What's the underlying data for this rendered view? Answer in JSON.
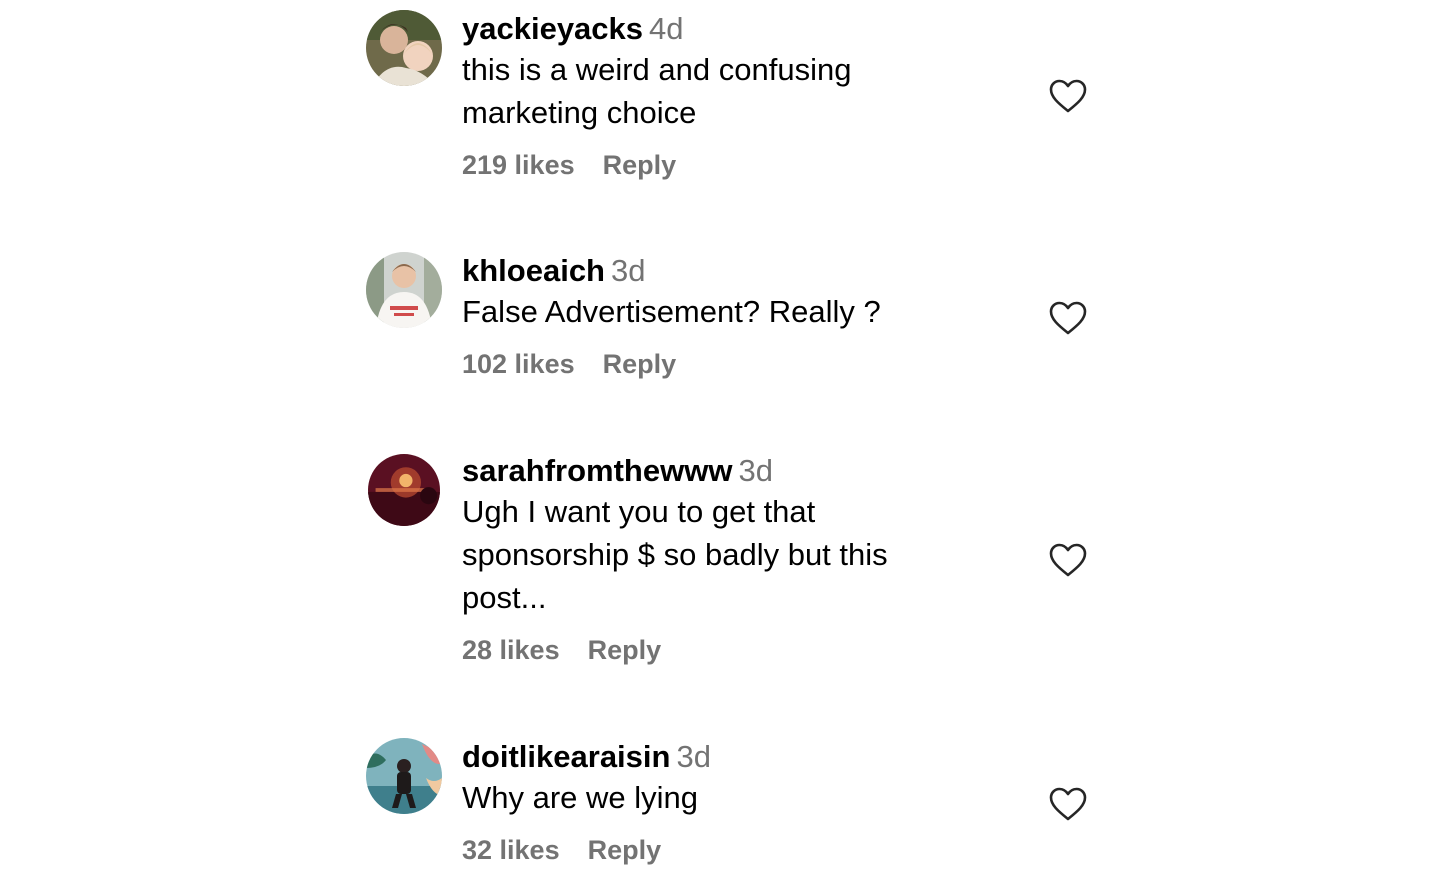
{
  "comments": [
    {
      "username": "yackieyacks",
      "time": "4d",
      "text": "this is a weird and confusing marketing choice",
      "likes": "219 likes",
      "reply": "Reply",
      "avatar_icon": "profile-photo"
    },
    {
      "username": "khloeaich",
      "time": "3d",
      "text": "False Advertisement? Really ?",
      "likes": "102 likes",
      "reply": "Reply",
      "avatar_icon": "profile-photo"
    },
    {
      "username": "sarahfromthewww",
      "time": "3d",
      "text": "Ugh I want you to get that sponsorship $ so badly but this post...",
      "likes": "28 likes",
      "reply": "Reply",
      "avatar_icon": "profile-photo"
    },
    {
      "username": "doitlikearaisin",
      "time": "3d",
      "text": "Why are we lying",
      "likes": "32 likes",
      "reply": "Reply",
      "avatar_icon": "profile-photo"
    }
  ],
  "like_icon": "heart-outline-icon",
  "colors": {
    "text": "#000000",
    "secondary": "#737373",
    "heart_stroke": "#262626"
  }
}
